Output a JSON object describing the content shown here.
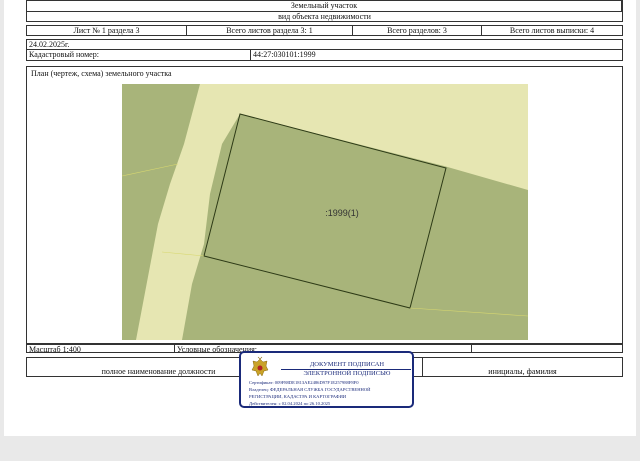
{
  "header": {
    "title": "Земельный участок",
    "subtitle": "вид объекта недвижимости"
  },
  "sheet_info": {
    "sheet": "Лист № 1 раздела 3",
    "sheets_in_section": "Всего листов раздела 3: 1",
    "sections_total": "Всего разделов: 3",
    "sheets_total": "Всего листов выписки: 4"
  },
  "date": "24.02.2025г.",
  "cadastral": {
    "label": "Кадастровый номер:",
    "value": "44:27:030101:1999"
  },
  "plan": {
    "title": "План (чертеж, схема) земельного участка",
    "parcel_label": ":1999(1)"
  },
  "footer": {
    "scale": "Масштаб 1:400",
    "legend": "Условные обозначения:",
    "position": "полное наименование должности",
    "name": "инициалы, фамилия"
  },
  "stamp": {
    "line1": "ДОКУМЕНТ ПОДПИСАН",
    "line2": "ЭЛЕКТРОННОЙ ПОДПИСЬЮ",
    "certificate": "Сертификат: 009F88DE1813AE2486D97F1E257988F8F0",
    "owner1": "Владелец: ФЕДЕРАЛЬНАЯ СЛУЖБА ГОСУДАРСТВЕННОЙ",
    "owner2": "РЕГИСТРАЦИИ, КАДАСТРА И КАРТОГРАФИИ",
    "valid": "Действителен: с 02.04.2024 по 26.10.2025"
  },
  "colors": {
    "parcel_fill": "#a8b47a",
    "road_fill": "#e6e6b2",
    "stamp_blue": "#1a2a7a"
  }
}
